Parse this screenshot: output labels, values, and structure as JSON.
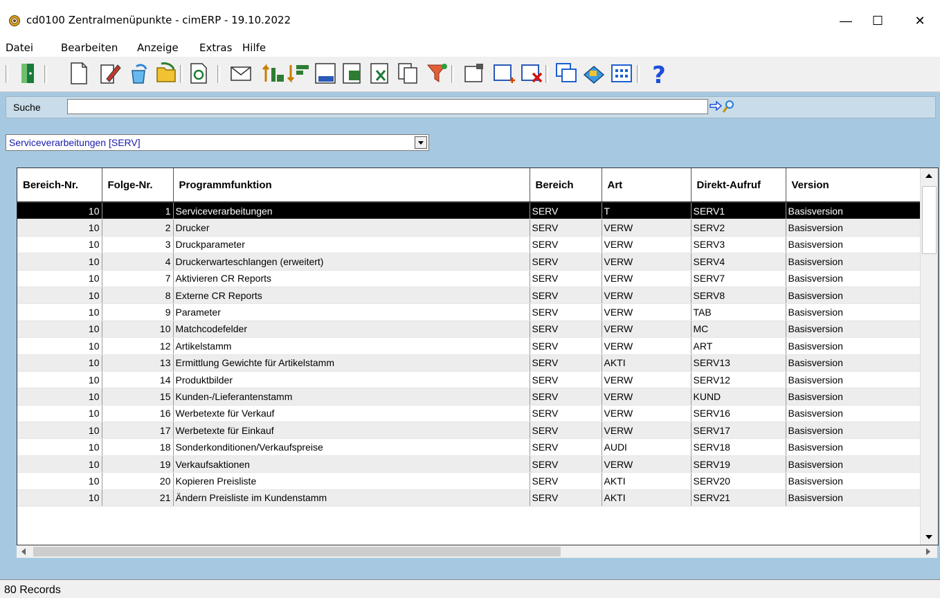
{
  "window": {
    "title": "cd0100 Zentralmenüpunkte - cimERP - 19.10.2022",
    "minimize": "—",
    "maximize": "☐",
    "close": "✕"
  },
  "menu": [
    "Datei",
    "Bearbeiten",
    "Anzeige",
    "Extras",
    "Hilfe"
  ],
  "toolbar_icons": [
    "exit-icon",
    "new-document-icon",
    "edit-icon",
    "copy-record-icon",
    "open-folder-icon",
    "refresh-icon",
    "mail-icon",
    "sort-ascending-icon",
    "sort-descending-icon",
    "numbers-report-icon",
    "export-icon",
    "excel-export-icon",
    "copy-pages-icon",
    "filter-icon",
    "properties-icon",
    "select-area-icon",
    "delete-icon",
    "windows-icon",
    "tools-icon",
    "grid-view-icon",
    "help-icon"
  ],
  "search": {
    "label": "Suche",
    "value": ""
  },
  "area_select": {
    "value": "Serviceverarbeitungen  [SERV]"
  },
  "table": {
    "columns": [
      "Bereich-Nr.",
      "Folge-Nr.",
      "Programmfunktion",
      "Bereich",
      "Art",
      "Direkt-Aufruf",
      "Version"
    ],
    "rows": [
      [
        "10",
        "1",
        "Serviceverarbeitungen",
        "SERV",
        "T",
        "SERV1",
        "Basisversion"
      ],
      [
        "10",
        "2",
        "Drucker",
        "SERV",
        "VERW",
        "SERV2",
        "Basisversion"
      ],
      [
        "10",
        "3",
        "Druckparameter",
        "SERV",
        "VERW",
        "SERV3",
        "Basisversion"
      ],
      [
        "10",
        "4",
        "Druckerwarteschlangen (erweitert)",
        "SERV",
        "VERW",
        "SERV4",
        "Basisversion"
      ],
      [
        "10",
        "7",
        "Aktivieren CR Reports",
        "SERV",
        "VERW",
        "SERV7",
        "Basisversion"
      ],
      [
        "10",
        "8",
        "Externe CR Reports",
        "SERV",
        "VERW",
        "SERV8",
        "Basisversion"
      ],
      [
        "10",
        "9",
        "Parameter",
        "SERV",
        "VERW",
        "TAB",
        "Basisversion"
      ],
      [
        "10",
        "10",
        "Matchcodefelder",
        "SERV",
        "VERW",
        "MC",
        "Basisversion"
      ],
      [
        "10",
        "12",
        "Artikelstamm",
        "SERV",
        "VERW",
        "ART",
        "Basisversion"
      ],
      [
        "10",
        "13",
        "Ermittlung Gewichte für Artikelstamm",
        "SERV",
        "AKTI",
        "SERV13",
        "Basisversion"
      ],
      [
        "10",
        "14",
        "Produktbilder",
        "SERV",
        "VERW",
        "SERV12",
        "Basisversion"
      ],
      [
        "10",
        "15",
        "Kunden-/Lieferantenstamm",
        "SERV",
        "VERW",
        "KUND",
        "Basisversion"
      ],
      [
        "10",
        "16",
        "Werbetexte für Verkauf",
        "SERV",
        "VERW",
        "SERV16",
        "Basisversion"
      ],
      [
        "10",
        "17",
        "Werbetexte für Einkauf",
        "SERV",
        "VERW",
        "SERV17",
        "Basisversion"
      ],
      [
        "10",
        "18",
        "Sonderkonditionen/Verkaufspreise",
        "SERV",
        "AUDI",
        "SERV18",
        "Basisversion"
      ],
      [
        "10",
        "19",
        "Verkaufsaktionen",
        "SERV",
        "VERW",
        "SERV19",
        "Basisversion"
      ],
      [
        "10",
        "20",
        "Kopieren Preisliste",
        "SERV",
        "AKTI",
        "SERV20",
        "Basisversion"
      ],
      [
        "10",
        "21",
        "Ändern Preisliste im Kundenstamm",
        "SERV",
        "AKTI",
        "SERV21",
        "Basisversion"
      ]
    ],
    "selected_row": 0
  },
  "status": {
    "text": "80 Records"
  },
  "colors": {
    "panel": "#a6c9e1",
    "selection": "#000000",
    "combo_text": "#1a1ab0"
  }
}
